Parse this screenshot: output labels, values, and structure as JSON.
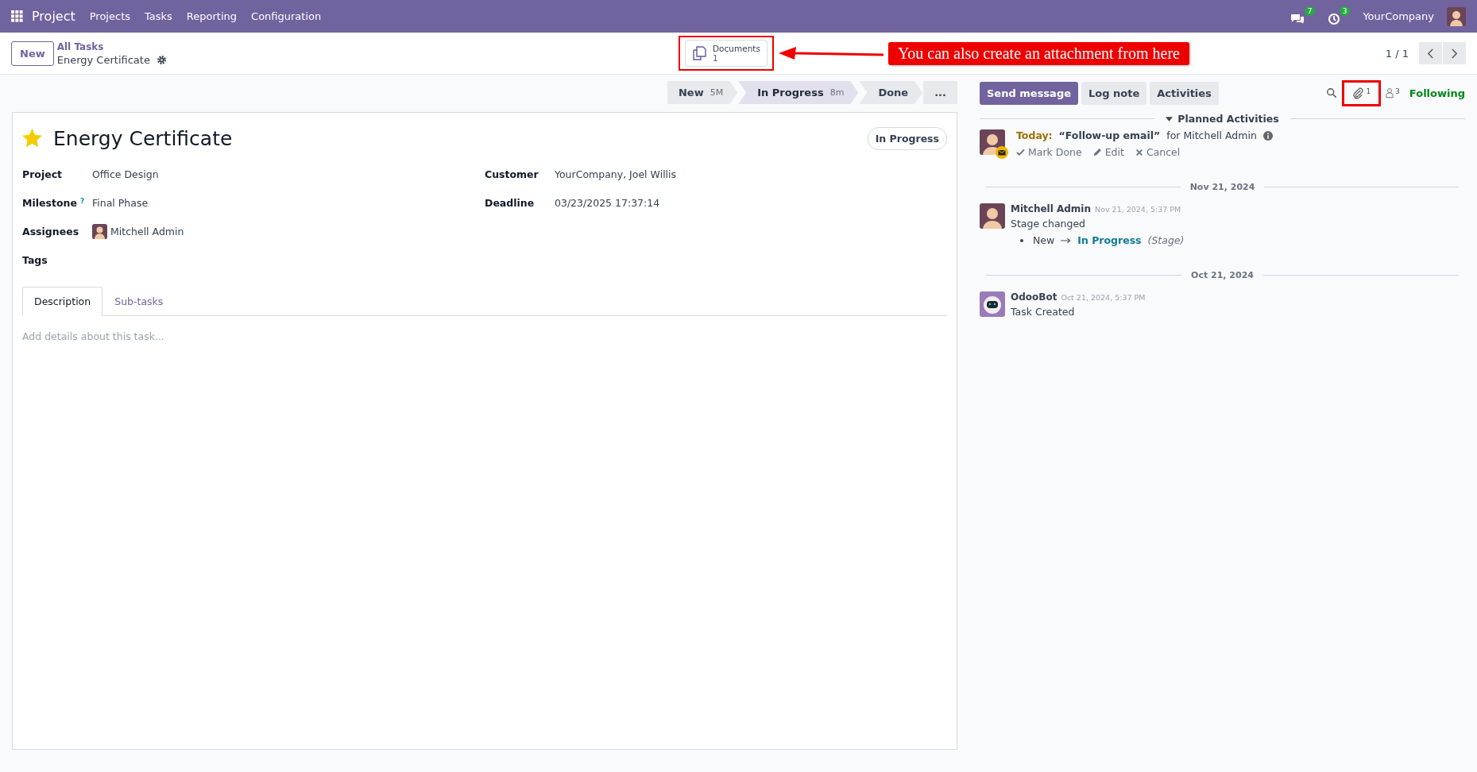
{
  "navbar": {
    "app_name": "Project",
    "menu": [
      "Projects",
      "Tasks",
      "Reporting",
      "Configuration"
    ],
    "messages_count": "7",
    "activities_count": "3",
    "company": "YourCompany"
  },
  "control_panel": {
    "new_button": "New",
    "breadcrumb": "All Tasks",
    "record_title": "Energy Certificate",
    "smart_button": {
      "label": "Documents",
      "count": "1",
      "highlighted": true
    },
    "annotation": "You can also create an attachment from here",
    "pager": "1 / 1"
  },
  "stages": [
    {
      "label": "New",
      "duration": "5M",
      "selected": false
    },
    {
      "label": "In Progress",
      "duration": "8m",
      "selected": true
    },
    {
      "label": "Done",
      "selected": false
    },
    {
      "label": "...",
      "selected": false
    }
  ],
  "form": {
    "starred": true,
    "title": "Energy Certificate",
    "status": "In Progress",
    "left_fields": [
      {
        "label": "Project",
        "value": "Office Design"
      },
      {
        "label": "Milestone",
        "help": "?",
        "value": "Final Phase"
      },
      {
        "label": "Assignees",
        "value": "Mitchell Admin",
        "avatar": true
      },
      {
        "label": "Tags"
      }
    ],
    "right_fields": [
      {
        "label": "Customer",
        "value": "YourCompany, Joel Willis"
      },
      {
        "label": "Deadline",
        "value": "03/23/2025 17:37:14"
      }
    ],
    "tabs": [
      {
        "label": "Description",
        "selected": true
      },
      {
        "label": "Sub-tasks",
        "selected": false
      }
    ],
    "description_placeholder": "Add details about this task..."
  },
  "chatter": {
    "buttons": [
      {
        "label": "Send message",
        "selected": true
      },
      {
        "label": "Log note",
        "selected": false
      },
      {
        "label": "Activities",
        "selected": false
      }
    ],
    "attachments": {
      "count": "1",
      "highlighted": true
    },
    "followers_count": "3",
    "follow_status": "Following",
    "planned_heading": "Planned Activities",
    "activity": {
      "due": "Today:",
      "summary": "“Follow-up email”",
      "assignee": "for Mitchell Admin",
      "actions": [
        {
          "kind": "done",
          "label": "Mark Done"
        },
        {
          "kind": "edit",
          "label": "Edit"
        },
        {
          "kind": "cancel",
          "label": "Cancel"
        }
      ]
    },
    "groups": [
      {
        "date": "Nov 21, 2024",
        "messages": [
          {
            "kind": "person",
            "author": "Mitchell Admin",
            "time": "Nov 21, 2024, 5:37 PM",
            "body": "Stage changed",
            "tracking": {
              "old": "New",
              "new": "In Progress",
              "field": "(Stage)"
            }
          }
        ]
      },
      {
        "date": "Oct 21, 2024",
        "messages": [
          {
            "kind": "bot",
            "author": "OdooBot",
            "time": "Oct 21, 2024, 5:37 PM",
            "body": "Task Created"
          }
        ]
      }
    ]
  }
}
